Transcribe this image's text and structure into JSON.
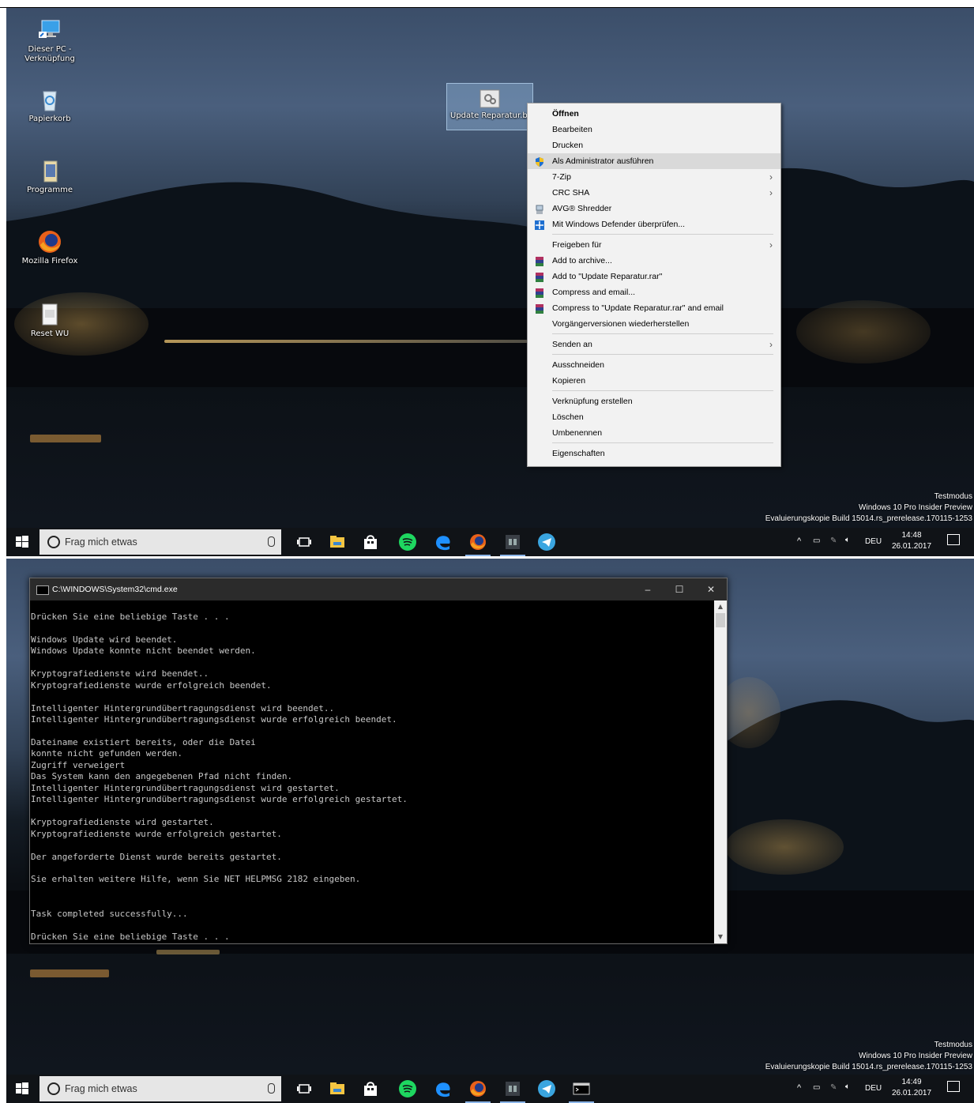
{
  "top_panel": {
    "desktop_icons": [
      {
        "name": "this-pc-shortcut",
        "label": "Dieser PC - Verknüpfung"
      },
      {
        "name": "recycle-bin",
        "label": "Papierkorb"
      },
      {
        "name": "programs-folder",
        "label": "Programme"
      },
      {
        "name": "firefox-shortcut",
        "label": "Mozilla Firefox"
      },
      {
        "name": "reset-wu",
        "label": "Reset WU"
      }
    ],
    "selected_file_label": "Update Reparatur.ba",
    "context_menu": [
      {
        "type": "item",
        "label": "Öffnen",
        "bold": true
      },
      {
        "type": "item",
        "label": "Bearbeiten"
      },
      {
        "type": "item",
        "label": "Drucken"
      },
      {
        "type": "item",
        "label": "Als Administrator ausführen",
        "icon": "uac-shield-icon",
        "highlight": true
      },
      {
        "type": "item",
        "label": "7-Zip",
        "submenu": true
      },
      {
        "type": "item",
        "label": "CRC SHA",
        "submenu": true
      },
      {
        "type": "item",
        "label": "AVG® Shredder",
        "icon": "shredder-icon"
      },
      {
        "type": "item",
        "label": "Mit Windows Defender überprüfen...",
        "icon": "defender-icon"
      },
      {
        "type": "sep"
      },
      {
        "type": "item",
        "label": "Freigeben für",
        "submenu": true
      },
      {
        "type": "item",
        "label": "Add to archive...",
        "icon": "winrar-icon"
      },
      {
        "type": "item",
        "label": "Add to \"Update Reparatur.rar\"",
        "icon": "winrar-icon"
      },
      {
        "type": "item",
        "label": "Compress and email...",
        "icon": "winrar-icon"
      },
      {
        "type": "item",
        "label": "Compress to \"Update Reparatur.rar\" and email",
        "icon": "winrar-icon"
      },
      {
        "type": "item",
        "label": "Vorgängerversionen wiederherstellen"
      },
      {
        "type": "sep"
      },
      {
        "type": "item",
        "label": "Senden an",
        "submenu": true
      },
      {
        "type": "sep"
      },
      {
        "type": "item",
        "label": "Ausschneiden"
      },
      {
        "type": "item",
        "label": "Kopieren"
      },
      {
        "type": "sep"
      },
      {
        "type": "item",
        "label": "Verknüpfung erstellen"
      },
      {
        "type": "item",
        "label": "Löschen"
      },
      {
        "type": "item",
        "label": "Umbenennen"
      },
      {
        "type": "sep"
      },
      {
        "type": "item",
        "label": "Eigenschaften"
      }
    ],
    "clock": {
      "time": "14:48",
      "date": "26.01.2017"
    }
  },
  "bottom_panel": {
    "cmd": {
      "title": "C:\\WINDOWS\\System32\\cmd.exe",
      "output": "Drücken Sie eine beliebige Taste . . .\n\nWindows Update wird beendet.\nWindows Update konnte nicht beendet werden.\n\nKryptografiedienste wird beendet..\nKryptografiedienste wurde erfolgreich beendet.\n\nIntelligenter Hintergrundübertragungsdienst wird beendet..\nIntelligenter Hintergrundübertragungsdienst wurde erfolgreich beendet.\n\nDateiname existiert bereits, oder die Datei\nkonnte nicht gefunden werden.\nZugriff verweigert\nDas System kann den angegebenen Pfad nicht finden.\nIntelligenter Hintergrundübertragungsdienst wird gestartet.\nIntelligenter Hintergrundübertragungsdienst wurde erfolgreich gestartet.\n\nKryptografiedienste wird gestartet.\nKryptografiedienste wurde erfolgreich gestartet.\n\nDer angeforderte Dienst wurde bereits gestartet.\n\nSie erhalten weitere Hilfe, wenn Sie NET HELPMSG 2182 eingeben.\n\n\nTask completed successfully...\n\nDrücken Sie eine beliebige Taste . . ."
    },
    "clock": {
      "time": "14:49",
      "date": "26.01.2017"
    }
  },
  "taskbar": {
    "search_placeholder": "Frag mich etwas",
    "language": "DEU"
  },
  "watermark": {
    "line1": "Testmodus",
    "line2": "Windows 10 Pro Insider Preview",
    "line3": "Evaluierungskopie Build 15014.rs_prerelease.170115-1253"
  },
  "colors": {
    "accent": "#8ab4e8",
    "menu_bg": "#f2f2f2",
    "taskbar": "#101317",
    "cmd_bg": "#000000",
    "cmd_text": "#c8c8c8"
  }
}
